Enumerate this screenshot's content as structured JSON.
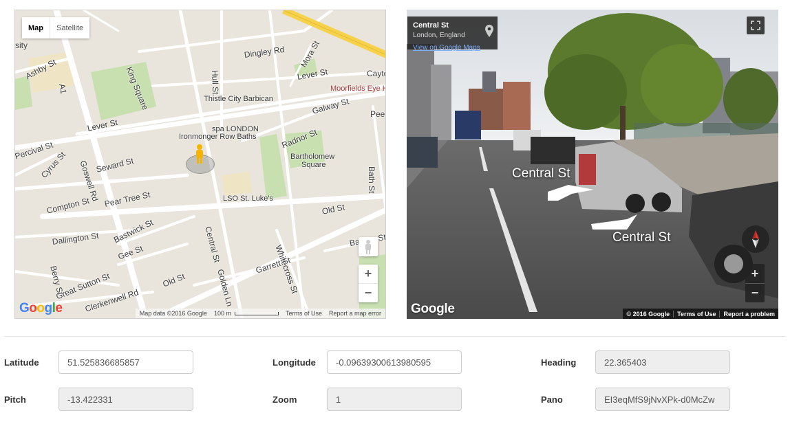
{
  "map": {
    "type_buttons": [
      "Map",
      "Satellite"
    ],
    "streets": [
      {
        "text": "Ashby St"
      },
      {
        "text": "A1"
      },
      {
        "text": "King Square"
      },
      {
        "text": "Hull St"
      },
      {
        "text": "Dingley Rd"
      },
      {
        "text": "Mora St"
      },
      {
        "text": "Lever St"
      },
      {
        "text": "Lever St"
      },
      {
        "text": "Galway St"
      },
      {
        "text": "Percival St"
      },
      {
        "text": "Cyrus St"
      },
      {
        "text": "Seward St"
      },
      {
        "text": "Goswell Rd"
      },
      {
        "text": "Compton St"
      },
      {
        "text": "Pear Tree St"
      },
      {
        "text": "Radnor St"
      },
      {
        "text": "Old St"
      },
      {
        "text": "Dallington St"
      },
      {
        "text": "Bastwick St"
      },
      {
        "text": "Gee St"
      },
      {
        "text": "Berry St"
      },
      {
        "text": "Great Sutton St"
      },
      {
        "text": "Old St"
      },
      {
        "text": "Central St"
      },
      {
        "text": "Golden Ln"
      },
      {
        "text": "Garrett St"
      },
      {
        "text": "Whitecross St"
      },
      {
        "text": "Bath St"
      },
      {
        "text": "Banner St"
      },
      {
        "text": "Clerkenwell Rd"
      },
      {
        "text": "Peer"
      },
      {
        "text": "Cayto"
      },
      {
        "text": "sity"
      }
    ],
    "pois": [
      {
        "text": "Thistle City Barbican"
      },
      {
        "text": "spa LONDON"
      },
      {
        "text": "Ironmonger Row Baths"
      },
      {
        "text": "Bartholomew"
      },
      {
        "text": "Square"
      },
      {
        "text": "LSO St. Luke's"
      },
      {
        "text": "Moorfields Eye H"
      }
    ],
    "logo": "Google",
    "footer": {
      "data": "Map data ©2016 Google",
      "scale": "100 m",
      "terms": "Terms of Use",
      "report": "Report a map error"
    },
    "zoom_in": "+",
    "zoom_out": "−"
  },
  "streetview": {
    "address_title": "Central St",
    "address_sub": "London, England",
    "address_link": "View on Google Maps",
    "labels": [
      "Central St",
      "Central St"
    ],
    "logo": "Google",
    "footer": [
      "© 2016 Google",
      "Terms of Use",
      "Report a problem"
    ],
    "zoom_in": "+",
    "zoom_out": "−"
  },
  "form": {
    "latitude": {
      "label": "Latitude",
      "value": "51.525836685857"
    },
    "longitude": {
      "label": "Longitude",
      "value": "-0.09639300613980595"
    },
    "heading": {
      "label": "Heading",
      "value": "22.365403"
    },
    "pitch": {
      "label": "Pitch",
      "value": "-13.422331"
    },
    "zoom": {
      "label": "Zoom",
      "value": "1"
    },
    "pano": {
      "label": "Pano",
      "value": "EI3eqMfS9jNvXPk-d0McZw"
    }
  }
}
